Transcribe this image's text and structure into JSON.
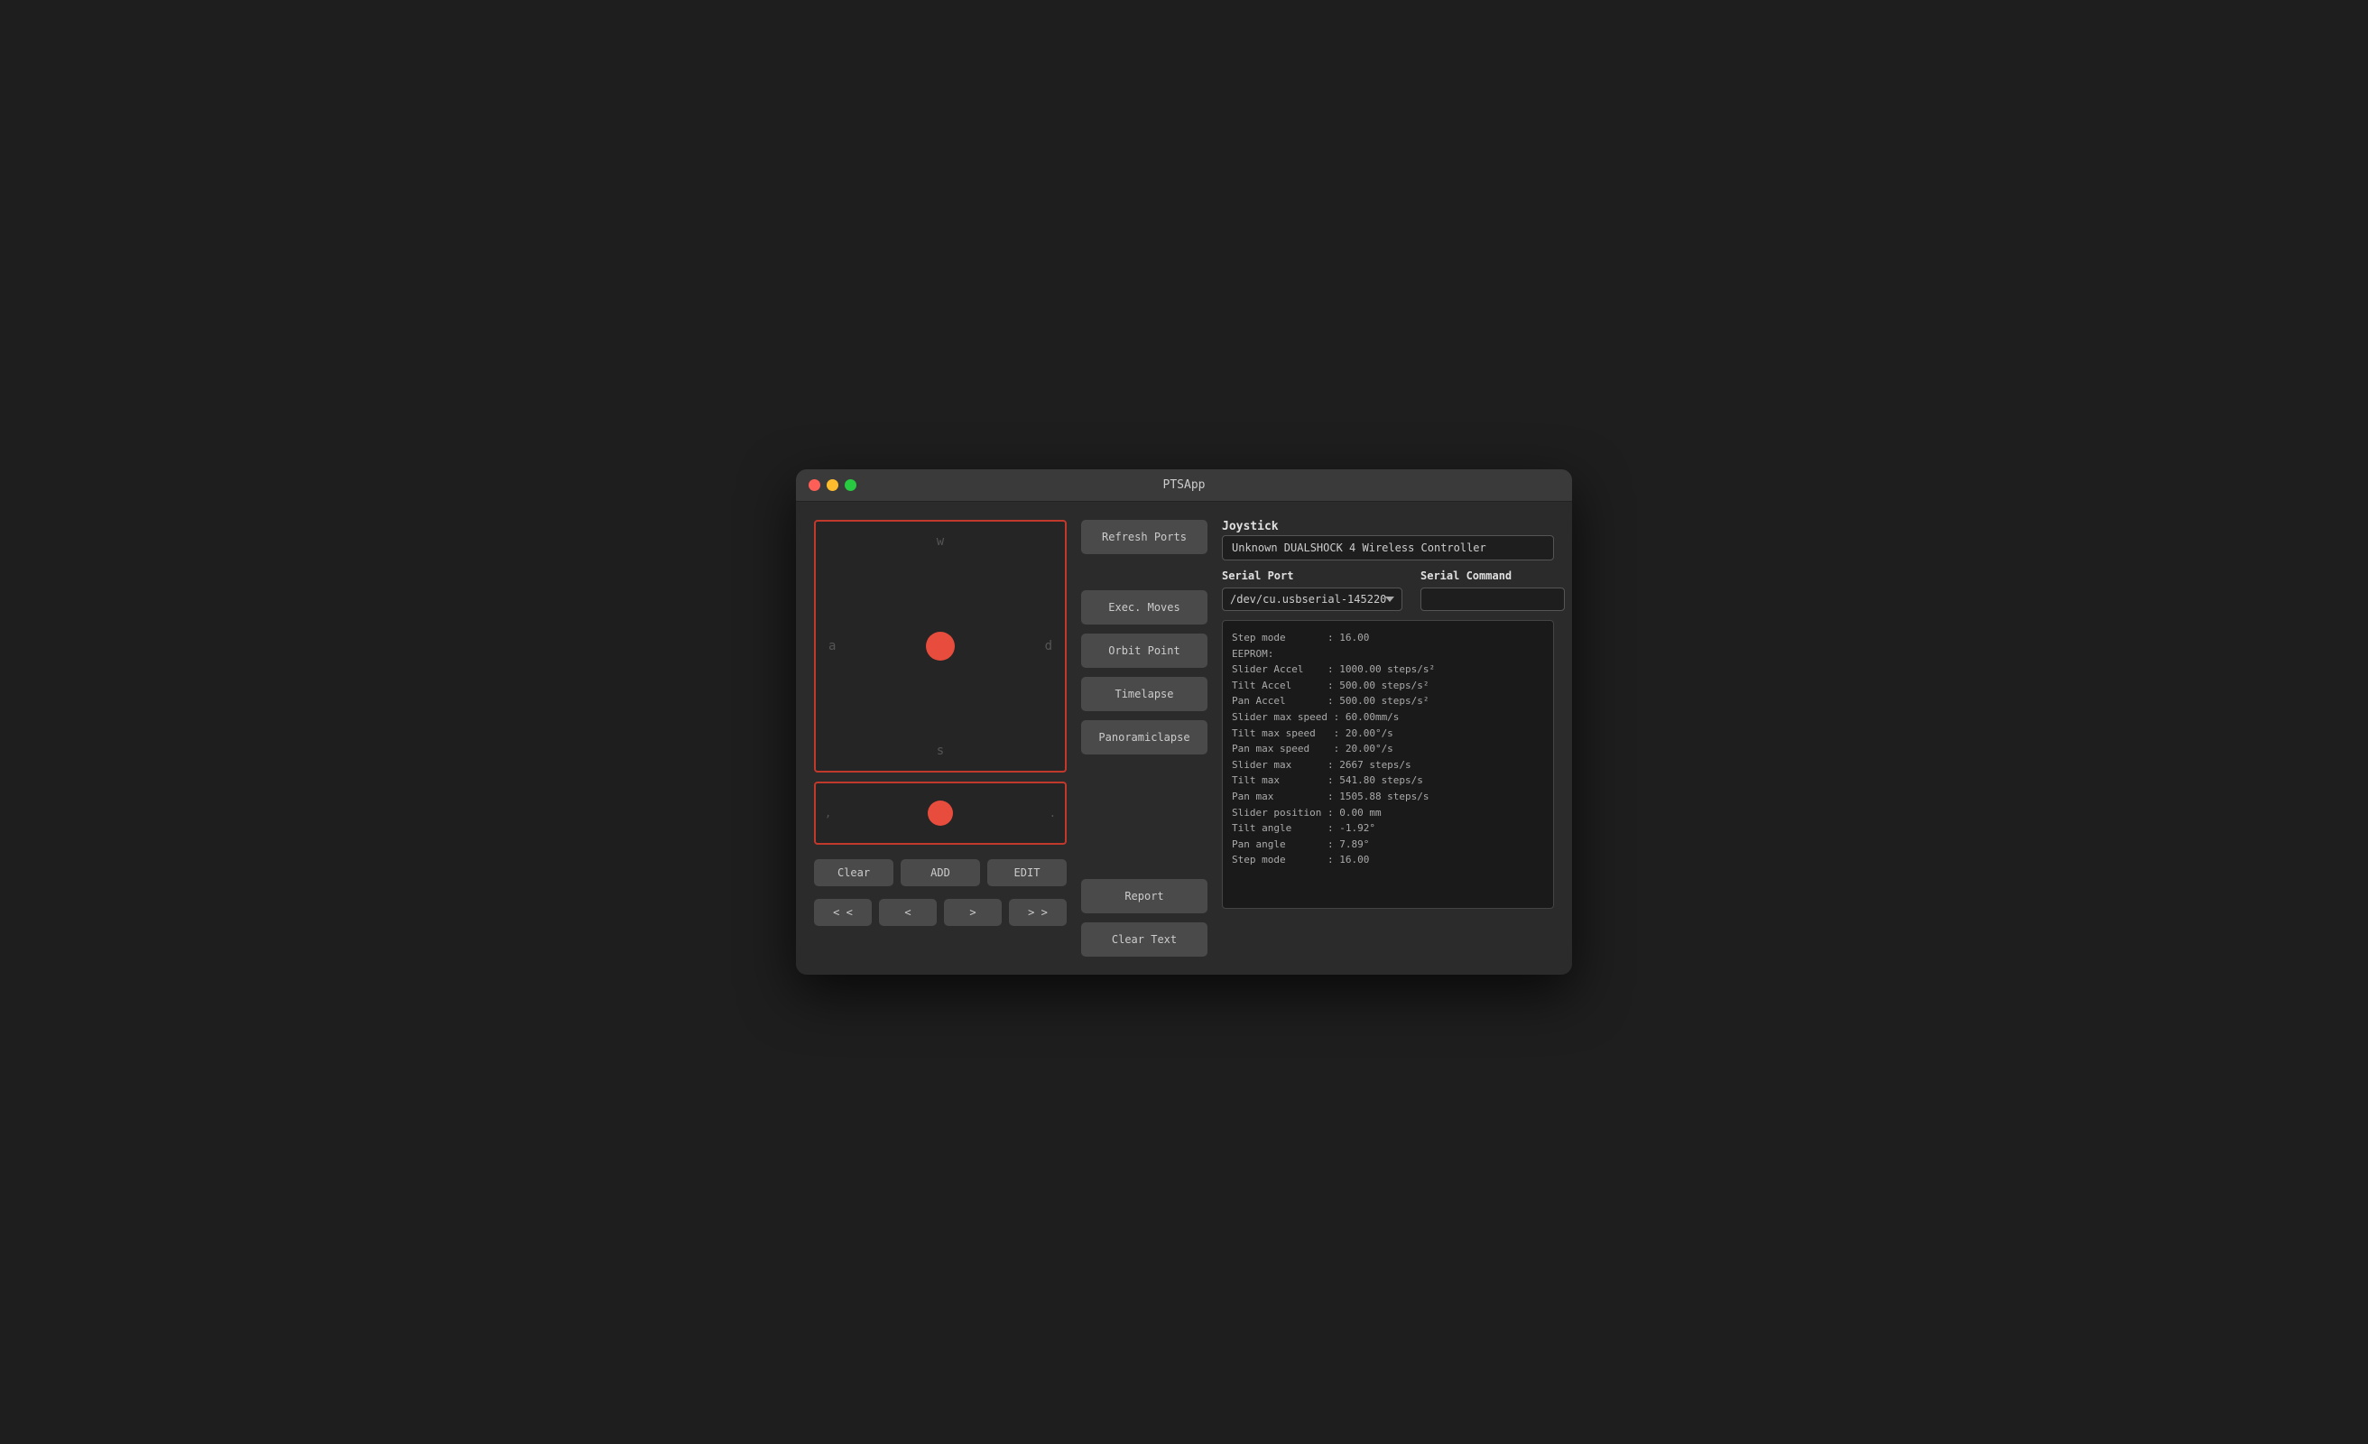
{
  "window": {
    "title": "PTSApp"
  },
  "joystick": {
    "label": "Joystick",
    "device": "Unknown DUALSHOCK 4 Wireless Controller"
  },
  "serialPort": {
    "label": "Serial Port",
    "value": "/dev/cu.usbserial-145220",
    "options": [
      "/dev/cu.usbserial-145220"
    ]
  },
  "serialCommand": {
    "label": "Serial Command",
    "placeholder": "",
    "value": ""
  },
  "wasd": {
    "top": "w",
    "bottom": "s",
    "left": "a",
    "right": "d"
  },
  "secondary": {
    "left": ",",
    "right": "."
  },
  "buttons": {
    "refreshPorts": "Refresh Ports",
    "execMoves": "Exec. Moves",
    "orbitPoint": "Orbit Point",
    "timelapse": "Timelapse",
    "panoramiclapse": "Panoramiclapse",
    "report": "Report",
    "clearText": "Clear Text",
    "clear": "Clear",
    "add": "ADD",
    "edit": "EDIT",
    "prevPrev": "< <",
    "prev": "<",
    "next": ">",
    "nextNext": "> >"
  },
  "console": {
    "lines": [
      "Step mode       : 16.00",
      "EEPROM:",
      "",
      "Slider Accel    : 1000.00 steps/s²",
      "Tilt Accel      : 500.00 steps/s²",
      "Pan Accel       : 500.00 steps/s²",
      "",
      "Slider max speed : 60.00mm/s",
      "Tilt max speed   : 20.00°/s",
      "Pan max speed    : 20.00°/s",
      "",
      "Slider max      : 2667 steps/s",
      "Tilt max        : 541.80 steps/s",
      "Pan max         : 1505.88 steps/s",
      "",
      "Slider position : 0.00 mm",
      "Tilt angle      : -1.92°",
      "Pan angle       : 7.89°",
      "",
      "Step mode       : 16.00"
    ]
  }
}
